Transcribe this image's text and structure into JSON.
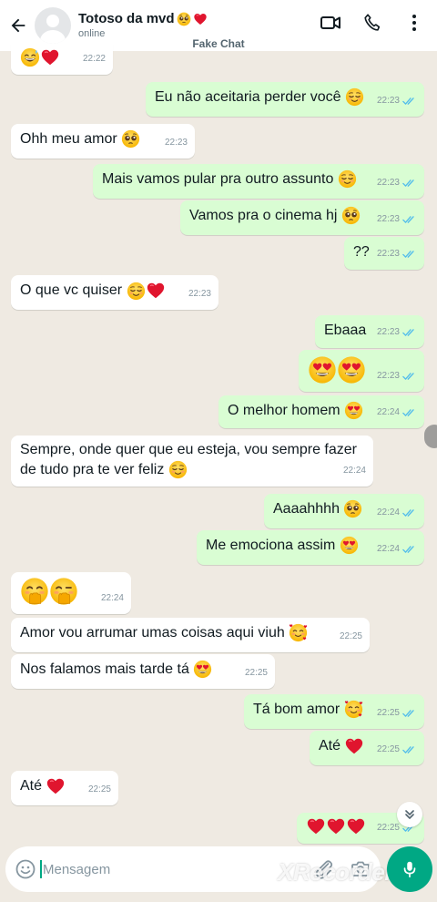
{
  "header": {
    "contact_name": "Totoso da mvd",
    "contact_emojis": [
      "pleading",
      "red-heart"
    ],
    "status": "online",
    "fake_label": "Fake Chat",
    "icons": [
      "back-arrow-icon",
      "video-call-icon",
      "phone-icon",
      "more-options-icon"
    ]
  },
  "colors": {
    "incoming_bubble": "#ffffff",
    "outgoing_bubble": "#d9fdd3",
    "chat_background": "#efeae2",
    "read_ticks": "#53bdeb",
    "accent": "#00a884"
  },
  "messages": [
    {
      "dir": "in",
      "text": "",
      "emojis": [
        "grin-sweat",
        "red-heart"
      ],
      "time": "22:22"
    },
    {
      "dir": "out",
      "text": "Eu não aceitaria perder você",
      "emojis": [
        "relieved"
      ],
      "time": "22:23"
    },
    {
      "dir": "in",
      "text": "Ohh meu amor",
      "emojis": [
        "pleading"
      ],
      "time": "22:23"
    },
    {
      "dir": "out",
      "text": "Mais vamos pular pra outro assunto",
      "emojis": [
        "relieved"
      ],
      "time": "22:23"
    },
    {
      "dir": "out",
      "text": "Vamos pra o cinema hj",
      "emojis": [
        "pleading"
      ],
      "time": "22:23"
    },
    {
      "dir": "out",
      "text": "??",
      "emojis": [],
      "time": "22:23"
    },
    {
      "dir": "in",
      "text": "O que vc quiser",
      "emojis": [
        "relieved",
        "red-heart"
      ],
      "time": "22:23"
    },
    {
      "dir": "out",
      "text": "Ebaaa",
      "emojis": [],
      "time": "22:23"
    },
    {
      "dir": "out",
      "text": "",
      "emojis": [
        "heart-eyes",
        "heart-eyes"
      ],
      "time": "22:23"
    },
    {
      "dir": "out",
      "text": "O melhor homem",
      "emojis": [
        "heart-eyes"
      ],
      "time": "22:24"
    },
    {
      "dir": "in",
      "text_line1": "Sempre, onde quer que eu esteja, vou sempre fazer",
      "text_line2": "de tudo pra te ver feliz",
      "emojis": [
        "relieved"
      ],
      "time": "22:24"
    },
    {
      "dir": "out",
      "text": "Aaaahhhh",
      "emojis": [
        "pleading"
      ],
      "time": "22:24"
    },
    {
      "dir": "out",
      "text": "Me emociona assim",
      "emojis": [
        "heart-eyes"
      ],
      "time": "22:24"
    },
    {
      "dir": "in",
      "text": "",
      "emojis": [
        "hand-over-mouth",
        "hand-over-mouth-wink"
      ],
      "time": "22:24"
    },
    {
      "dir": "in",
      "text": "Amor vou arrumar umas coisas aqui viuh",
      "emojis": [
        "smiling-hearts"
      ],
      "time": "22:25"
    },
    {
      "dir": "in",
      "text": "Nos falamos mais tarde tá",
      "emojis": [
        "heart-eyes"
      ],
      "time": "22:25"
    },
    {
      "dir": "out",
      "text": "Tá bom amor",
      "emojis": [
        "smiling-hearts"
      ],
      "time": "22:25"
    },
    {
      "dir": "out",
      "text": "Até",
      "emojis": [
        "red-heart"
      ],
      "time": "22:25"
    },
    {
      "dir": "in",
      "text": "Até",
      "emojis": [
        "red-heart"
      ],
      "time": "22:25"
    },
    {
      "dir": "out",
      "text": "",
      "emojis": [
        "red-heart",
        "red-heart",
        "red-heart"
      ],
      "time": "22:25"
    }
  ],
  "input": {
    "placeholder": "Mensagem",
    "icons": [
      "emoji-icon",
      "attach-icon",
      "camera-icon",
      "mic-icon"
    ]
  },
  "watermark": "XRecorder"
}
